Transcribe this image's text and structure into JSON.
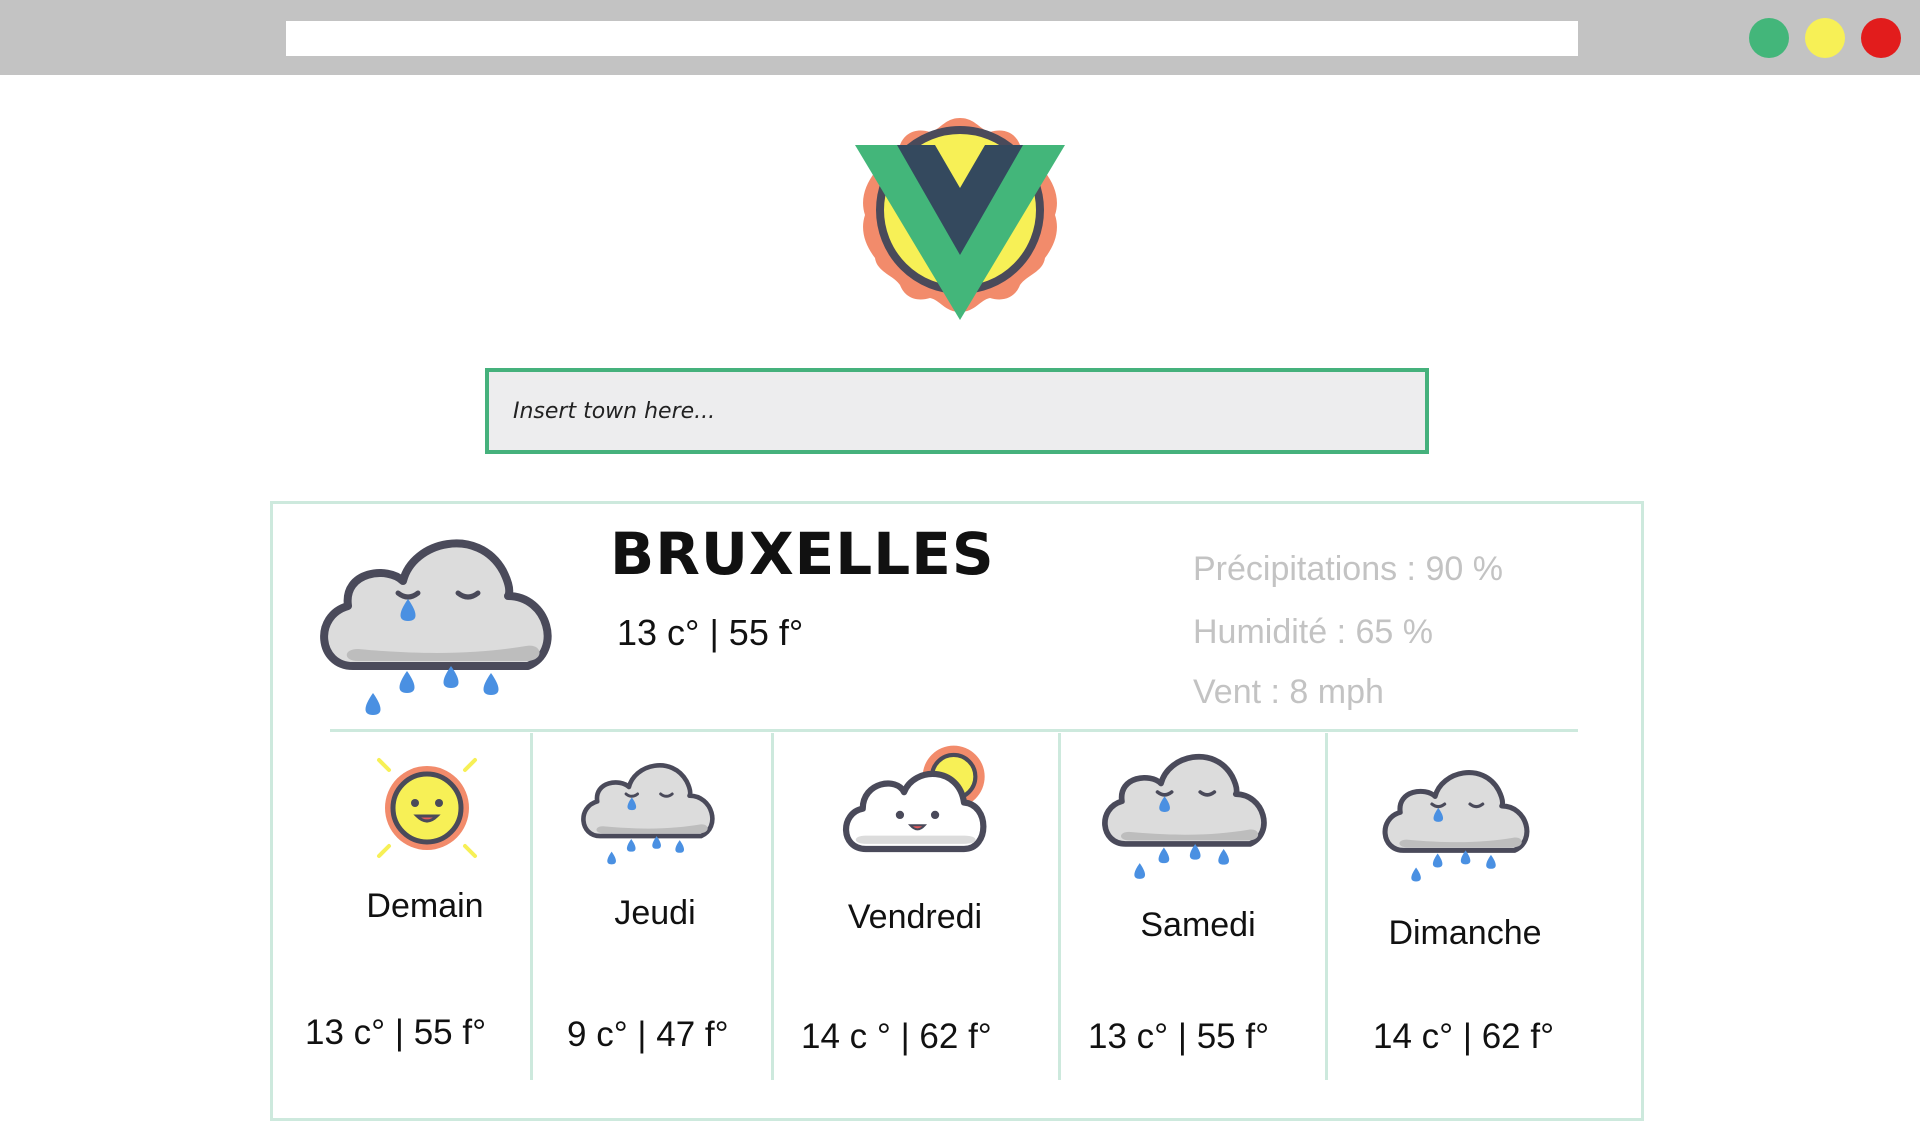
{
  "browser": {
    "url": "",
    "window_controls": [
      "green-dot",
      "yellow-dot",
      "red-dot"
    ]
  },
  "app": {
    "logo": "vue-sun-logo"
  },
  "search": {
    "placeholder": "Insert town here..."
  },
  "current": {
    "city": "BRUXELLES",
    "temp": "13 c° | 55 f°",
    "icon": "rain-cloud-icon",
    "stats": {
      "precip": "Précipitations : 90 %",
      "humidity": "Humidité : 65 %",
      "wind": "Vent : 8 mph"
    }
  },
  "forecast": [
    {
      "day": "Demain",
      "temp": "13 c° | 55 f°",
      "icon": "sun-icon"
    },
    {
      "day": "Jeudi",
      "temp": "9 c° | 47 f°",
      "icon": "rain-cloud-icon"
    },
    {
      "day": "Vendredi",
      "temp": "14 c ° | 62 f°",
      "icon": "partly-cloudy-icon"
    },
    {
      "day": "Samedi",
      "temp": "13 c° | 55 f°",
      "icon": "rain-cloud-icon"
    },
    {
      "day": "Dimanche",
      "temp": "14 c° | 62 f°",
      "icon": "rain-cloud-icon"
    }
  ],
  "colors": {
    "accent": "#43b67a",
    "border": "#cde9dd",
    "stat_text": "#c3c3c3"
  }
}
